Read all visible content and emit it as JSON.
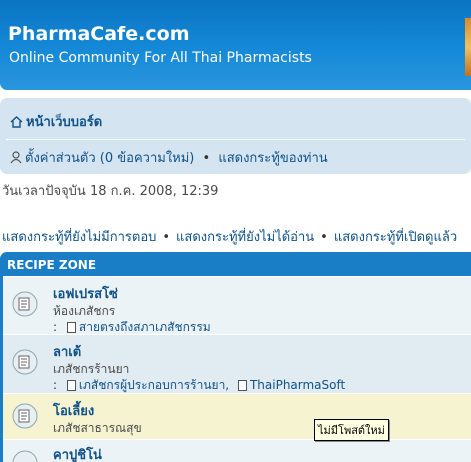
{
  "header": {
    "title": "PharmaCafe.com",
    "subtitle": "Online Community For All Thai Pharmacists"
  },
  "nav": {
    "board_index": "หน้าเว็บบอร์ด",
    "user_cp": "ตั้งค่าส่วนตัว (0 ข้อความใหม่)",
    "separator": "•",
    "your_posts": "แสดงกระทู้ของท่าน"
  },
  "time_text": "วันเวลาปัจจุบัน 18 ก.ค. 2008, 12:39",
  "quick_links": [
    "แสดงกระทู้ที่ยังไม่มีการตอบ",
    "แสดงกระทู้ที่ยังไม่ได้อ่าน",
    "แสดงกระทู้ที่เปิดดูแล้ว"
  ],
  "category": {
    "title": "RECIPE ZONE",
    "forums": [
      {
        "name": "เอฟเปรสโซ่",
        "desc": "ห้องเภสัชกร",
        "subs_label": ":",
        "subs": [
          "สายตรงถึงสภาเภสัชกรรม"
        ]
      },
      {
        "name": "ลาเต้",
        "desc": "เภสัชกรร้านยา",
        "subs_label": ":",
        "subs": [
          "เภสัชกรผู้ประกอบการร้านยา,",
          "ThaiPharmaSoft"
        ]
      },
      {
        "name": "โอเลี้ยง",
        "desc": "เภสัชสาธารณสุข"
      },
      {
        "name": "คาปูชิโน่",
        "desc": ""
      }
    ]
  },
  "tooltip": "ไม่มีโพสต์ใหม่",
  "colors": {
    "brand_blue": "#1a7ec6",
    "nav_bg": "#d4e4f1",
    "row_bg": "#ecf3f7",
    "row_highlight": "#f6f4d0",
    "link": "#105289"
  }
}
